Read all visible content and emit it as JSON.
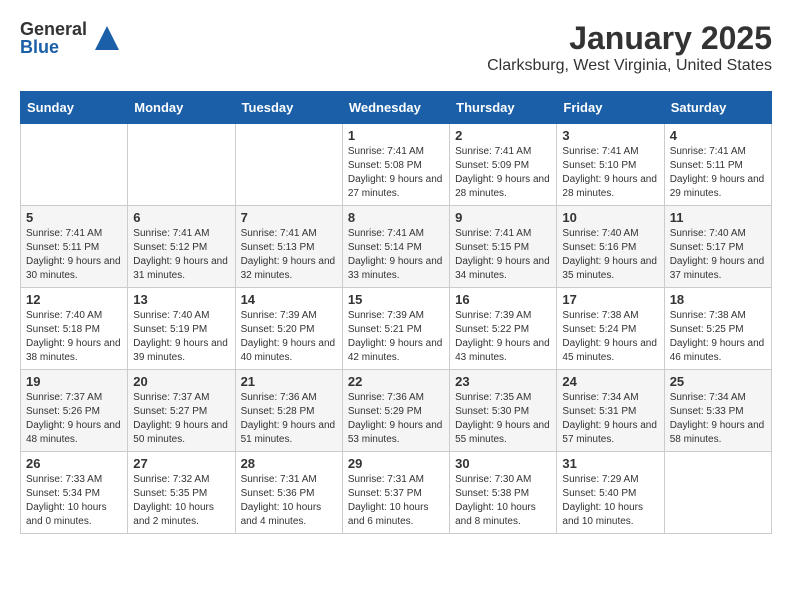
{
  "logo": {
    "general": "General",
    "blue": "Blue"
  },
  "title": "January 2025",
  "location": "Clarksburg, West Virginia, United States",
  "weekdays": [
    "Sunday",
    "Monday",
    "Tuesday",
    "Wednesday",
    "Thursday",
    "Friday",
    "Saturday"
  ],
  "weeks": [
    [
      {
        "day": "",
        "info": ""
      },
      {
        "day": "",
        "info": ""
      },
      {
        "day": "",
        "info": ""
      },
      {
        "day": "1",
        "info": "Sunrise: 7:41 AM\nSunset: 5:08 PM\nDaylight: 9 hours and 27 minutes."
      },
      {
        "day": "2",
        "info": "Sunrise: 7:41 AM\nSunset: 5:09 PM\nDaylight: 9 hours and 28 minutes."
      },
      {
        "day": "3",
        "info": "Sunrise: 7:41 AM\nSunset: 5:10 PM\nDaylight: 9 hours and 28 minutes."
      },
      {
        "day": "4",
        "info": "Sunrise: 7:41 AM\nSunset: 5:11 PM\nDaylight: 9 hours and 29 minutes."
      }
    ],
    [
      {
        "day": "5",
        "info": "Sunrise: 7:41 AM\nSunset: 5:11 PM\nDaylight: 9 hours and 30 minutes."
      },
      {
        "day": "6",
        "info": "Sunrise: 7:41 AM\nSunset: 5:12 PM\nDaylight: 9 hours and 31 minutes."
      },
      {
        "day": "7",
        "info": "Sunrise: 7:41 AM\nSunset: 5:13 PM\nDaylight: 9 hours and 32 minutes."
      },
      {
        "day": "8",
        "info": "Sunrise: 7:41 AM\nSunset: 5:14 PM\nDaylight: 9 hours and 33 minutes."
      },
      {
        "day": "9",
        "info": "Sunrise: 7:41 AM\nSunset: 5:15 PM\nDaylight: 9 hours and 34 minutes."
      },
      {
        "day": "10",
        "info": "Sunrise: 7:40 AM\nSunset: 5:16 PM\nDaylight: 9 hours and 35 minutes."
      },
      {
        "day": "11",
        "info": "Sunrise: 7:40 AM\nSunset: 5:17 PM\nDaylight: 9 hours and 37 minutes."
      }
    ],
    [
      {
        "day": "12",
        "info": "Sunrise: 7:40 AM\nSunset: 5:18 PM\nDaylight: 9 hours and 38 minutes."
      },
      {
        "day": "13",
        "info": "Sunrise: 7:40 AM\nSunset: 5:19 PM\nDaylight: 9 hours and 39 minutes."
      },
      {
        "day": "14",
        "info": "Sunrise: 7:39 AM\nSunset: 5:20 PM\nDaylight: 9 hours and 40 minutes."
      },
      {
        "day": "15",
        "info": "Sunrise: 7:39 AM\nSunset: 5:21 PM\nDaylight: 9 hours and 42 minutes."
      },
      {
        "day": "16",
        "info": "Sunrise: 7:39 AM\nSunset: 5:22 PM\nDaylight: 9 hours and 43 minutes."
      },
      {
        "day": "17",
        "info": "Sunrise: 7:38 AM\nSunset: 5:24 PM\nDaylight: 9 hours and 45 minutes."
      },
      {
        "day": "18",
        "info": "Sunrise: 7:38 AM\nSunset: 5:25 PM\nDaylight: 9 hours and 46 minutes."
      }
    ],
    [
      {
        "day": "19",
        "info": "Sunrise: 7:37 AM\nSunset: 5:26 PM\nDaylight: 9 hours and 48 minutes."
      },
      {
        "day": "20",
        "info": "Sunrise: 7:37 AM\nSunset: 5:27 PM\nDaylight: 9 hours and 50 minutes."
      },
      {
        "day": "21",
        "info": "Sunrise: 7:36 AM\nSunset: 5:28 PM\nDaylight: 9 hours and 51 minutes."
      },
      {
        "day": "22",
        "info": "Sunrise: 7:36 AM\nSunset: 5:29 PM\nDaylight: 9 hours and 53 minutes."
      },
      {
        "day": "23",
        "info": "Sunrise: 7:35 AM\nSunset: 5:30 PM\nDaylight: 9 hours and 55 minutes."
      },
      {
        "day": "24",
        "info": "Sunrise: 7:34 AM\nSunset: 5:31 PM\nDaylight: 9 hours and 57 minutes."
      },
      {
        "day": "25",
        "info": "Sunrise: 7:34 AM\nSunset: 5:33 PM\nDaylight: 9 hours and 58 minutes."
      }
    ],
    [
      {
        "day": "26",
        "info": "Sunrise: 7:33 AM\nSunset: 5:34 PM\nDaylight: 10 hours and 0 minutes."
      },
      {
        "day": "27",
        "info": "Sunrise: 7:32 AM\nSunset: 5:35 PM\nDaylight: 10 hours and 2 minutes."
      },
      {
        "day": "28",
        "info": "Sunrise: 7:31 AM\nSunset: 5:36 PM\nDaylight: 10 hours and 4 minutes."
      },
      {
        "day": "29",
        "info": "Sunrise: 7:31 AM\nSunset: 5:37 PM\nDaylight: 10 hours and 6 minutes."
      },
      {
        "day": "30",
        "info": "Sunrise: 7:30 AM\nSunset: 5:38 PM\nDaylight: 10 hours and 8 minutes."
      },
      {
        "day": "31",
        "info": "Sunrise: 7:29 AM\nSunset: 5:40 PM\nDaylight: 10 hours and 10 minutes."
      },
      {
        "day": "",
        "info": ""
      }
    ]
  ]
}
